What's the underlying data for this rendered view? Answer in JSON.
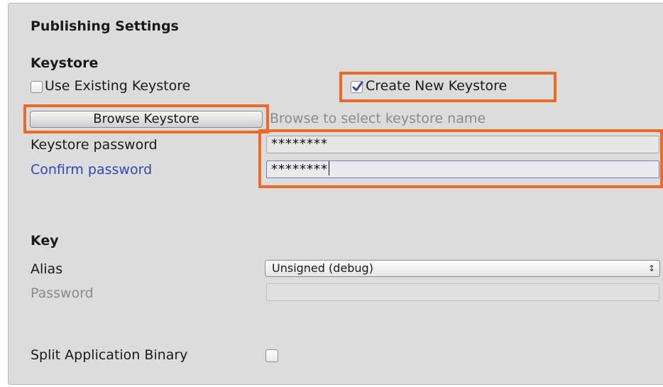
{
  "publishing": {
    "header": "Publishing Settings",
    "keystore": {
      "section_title": "Keystore",
      "use_existing_label": "Use Existing Keystore",
      "use_existing_checked": false,
      "create_new_label": "Create New Keystore",
      "create_new_checked": true,
      "browse_button_label": "Browse Keystore",
      "browse_hint": "Browse to select keystore name",
      "password_label": "Keystore password",
      "password_value": "********",
      "confirm_label": "Confirm password",
      "confirm_value": "********"
    },
    "key": {
      "section_title": "Key",
      "alias_label": "Alias",
      "alias_value": "Unsigned (debug)",
      "password_label": "Password",
      "password_value": ""
    },
    "split_binary": {
      "label": "Split Application Binary",
      "checked": false
    }
  },
  "colors": {
    "highlight": "#e96b25",
    "panel_bg": "#dcdcdc",
    "link_label": "#2a4bb0",
    "check_blue": "#2f4ea8"
  }
}
